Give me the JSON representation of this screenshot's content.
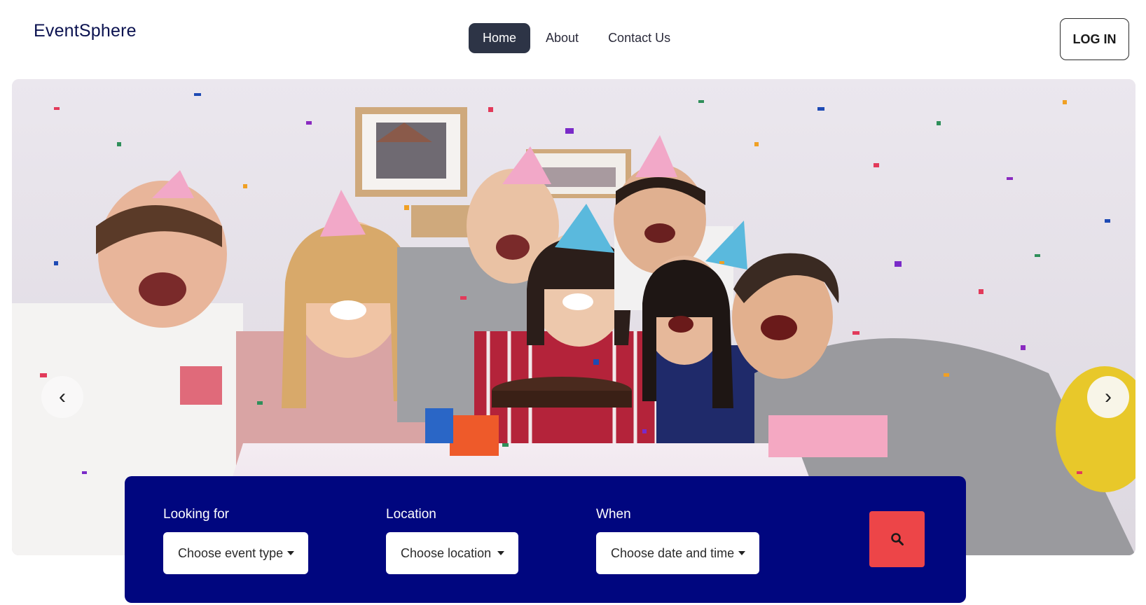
{
  "brand": {
    "name": "EventSphere"
  },
  "nav": {
    "items": [
      {
        "label": "Home",
        "active": true
      },
      {
        "label": "About",
        "active": false
      },
      {
        "label": "Contact Us",
        "active": false
      }
    ]
  },
  "header": {
    "login_label": "LOG IN"
  },
  "hero": {
    "prev_label": "‹",
    "next_label": "›",
    "image_description_icon": "party-photo"
  },
  "search": {
    "event": {
      "label": "Looking for",
      "value": "Choose event type"
    },
    "location": {
      "label": "Location",
      "value": "Choose location"
    },
    "when": {
      "label": "When",
      "value": "Choose date and time"
    },
    "button_icon": "search-icon"
  },
  "colors": {
    "accent_dark": "#2d3446",
    "panel": "#00067f",
    "search_button": "#ed4548",
    "brand_text": "#0b1250"
  }
}
